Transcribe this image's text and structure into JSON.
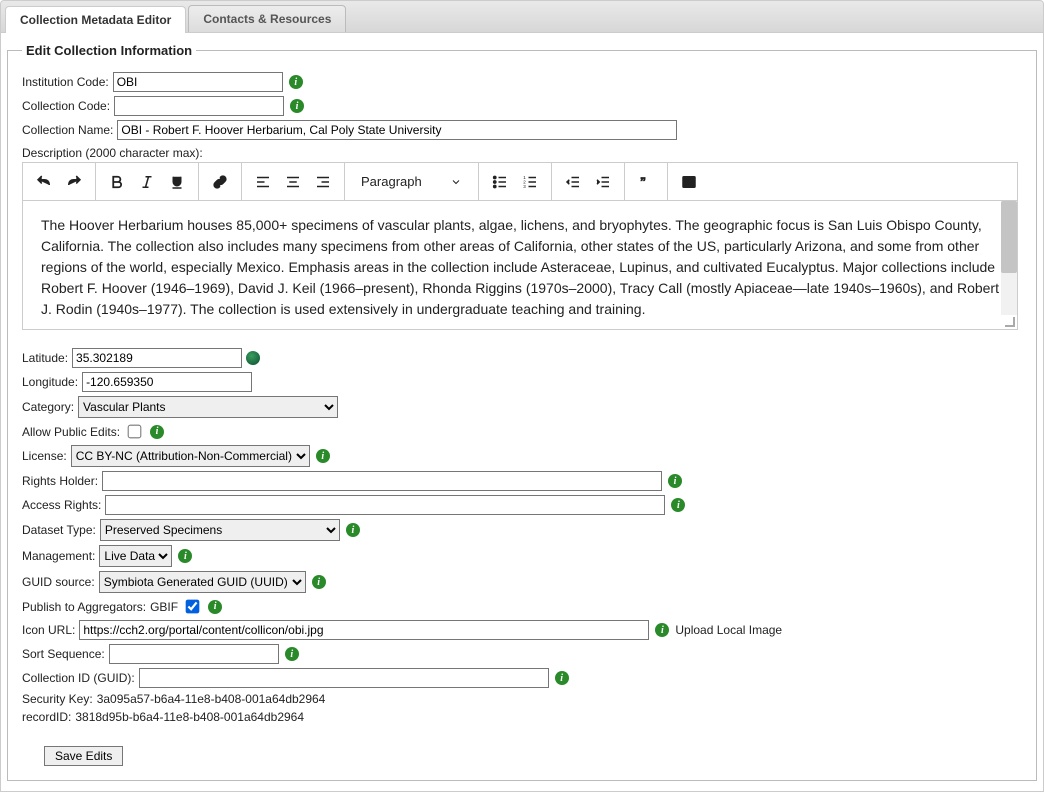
{
  "tabs": {
    "editor": "Collection Metadata Editor",
    "contacts": "Contacts & Resources"
  },
  "legend": "Edit Collection Information",
  "labels": {
    "institutionCode": "Institution Code:",
    "collectionCode": "Collection Code:",
    "collectionName": "Collection Name:",
    "description": "Description (2000 character max):",
    "latitude": "Latitude:",
    "longitude": "Longitude:",
    "category": "Category:",
    "allowPublicEdits": "Allow Public Edits:",
    "license": "License:",
    "rightsHolder": "Rights Holder:",
    "accessRights": "Access Rights:",
    "datasetType": "Dataset Type:",
    "management": "Management:",
    "guidSource": "GUID source:",
    "publishAgg": "Publish to Aggregators:",
    "gbif": "GBIF",
    "iconURL": "Icon URL:",
    "uploadLocal": "Upload Local Image",
    "sortSequence": "Sort Sequence:",
    "collectionGUID": "Collection ID (GUID):",
    "securityKey": "Security Key:",
    "recordID": "recordID:",
    "saveEdits": "Save Edits"
  },
  "values": {
    "institutionCode": "OBI",
    "collectionCode": "",
    "collectionName": "OBI - Robert F. Hoover Herbarium, Cal Poly State University",
    "descriptionBody": "The Hoover Herbarium houses 85,000+ specimens of vascular plants, algae, lichens, and bryophytes. The geographic focus is San Luis Obispo County, California. The collection also includes many specimens from other areas of California, other states of the US, particularly Arizona, and some from other regions of the world, especially Mexico. Emphasis areas in the collection include Asteraceae, Lupinus, and cultivated Eucalyptus. Major collections include Robert F. Hoover (1946–1969), David J. Keil (1966–present), Rhonda Riggins (1970s–2000), Tracy Call (mostly Apiaceae—late 1940s–1960s), and Robert J. Rodin (1940s–1977). The collection is used extensively in undergraduate teaching and training.",
    "latitude": "35.302189",
    "longitude": "-120.659350",
    "category": "Vascular Plants",
    "license": "CC BY-NC (Attribution-Non-Commercial)",
    "rightsHolder": "",
    "accessRights": "",
    "datasetType": "Preserved Specimens",
    "management": "Live Data",
    "guidSource": "Symbiota Generated GUID (UUID)",
    "iconURL": "https://cch2.org/portal/content/collicon/obi.jpg",
    "sortSequence": "",
    "collectionGUID": "",
    "securityKey": "3a095a57-b6a4-11e8-b408-001a64db2964",
    "recordID": "3818d95b-b6a4-11e8-b408-001a64db2964",
    "publishAggChecked": true,
    "allowPublicEditsChecked": false
  },
  "rte": {
    "paragraphLabel": "Paragraph"
  }
}
